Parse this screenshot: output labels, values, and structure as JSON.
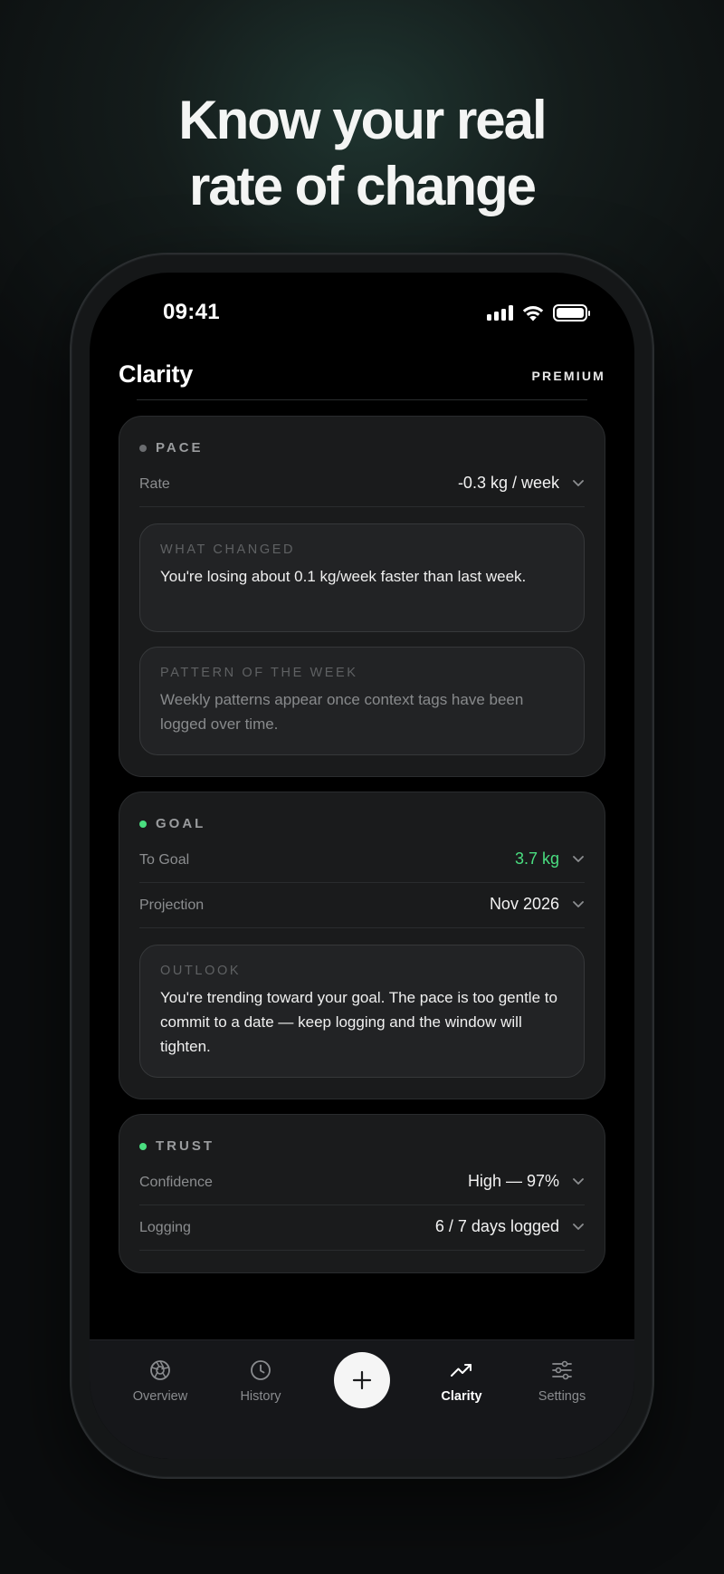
{
  "headline": {
    "line1": "Know your real",
    "line2": "rate of change"
  },
  "status_bar": {
    "time": "09:41"
  },
  "app": {
    "title": "Clarity",
    "badge": "PREMIUM"
  },
  "colors": {
    "accent_green": "#4ade80",
    "neutral_dot": "#6b6d70"
  },
  "pace": {
    "label": "PACE",
    "rate_label": "Rate",
    "rate_value": "-0.3 kg / week",
    "what_changed_label": "WHAT CHANGED",
    "what_changed_text": "You're losing about 0.1 kg/week faster than last week.",
    "pattern_label": "PATTERN OF THE WEEK",
    "pattern_text": "Weekly patterns appear once context tags have been logged over time."
  },
  "goal": {
    "label": "GOAL",
    "to_goal_label": "To Goal",
    "to_goal_value": "3.7 kg",
    "projection_label": "Projection",
    "projection_value": "Nov 2026",
    "outlook_label": "OUTLOOK",
    "outlook_text": "You're trending toward your goal. The pace is too gentle to commit to a date — keep logging and the window will tighten."
  },
  "trust": {
    "label": "TRUST",
    "confidence_label": "Confidence",
    "confidence_value": "High — 97%",
    "logging_label": "Logging",
    "logging_value": "6 / 7 days logged"
  },
  "tabbar": {
    "overview": "Overview",
    "history": "History",
    "clarity": "Clarity",
    "settings": "Settings",
    "active": "clarity"
  }
}
